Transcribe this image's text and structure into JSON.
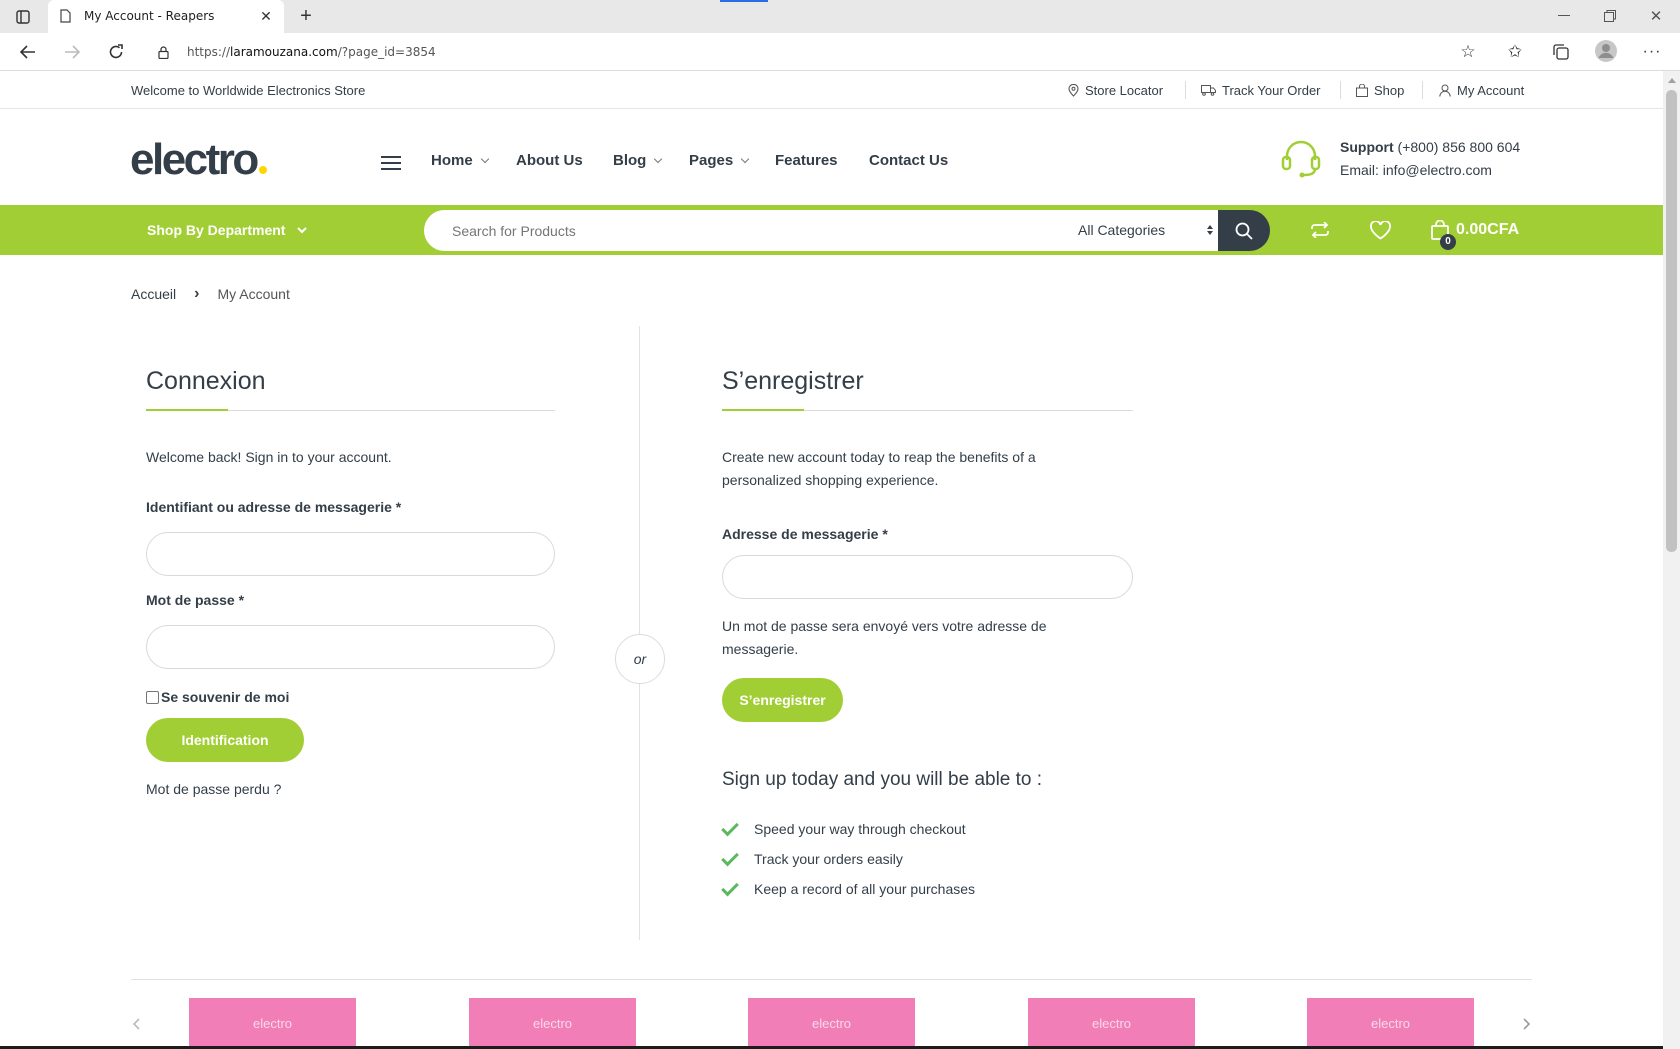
{
  "browser": {
    "tab_title": "My Account - Reapers",
    "url_domain": "laramouzana.com",
    "url_prefix": "https://",
    "url_path": "/?page_id=3854"
  },
  "topbar": {
    "welcome": "Welcome to Worldwide Electronics Store",
    "links": [
      "Store Locator",
      "Track Your Order",
      "Shop",
      "My Account"
    ]
  },
  "header": {
    "logo": "electro",
    "nav": [
      {
        "label": "Home",
        "has_dropdown": true
      },
      {
        "label": "About Us",
        "has_dropdown": false
      },
      {
        "label": "Blog",
        "has_dropdown": true
      },
      {
        "label": "Pages",
        "has_dropdown": true
      },
      {
        "label": "Features",
        "has_dropdown": false
      },
      {
        "label": "Contact Us",
        "has_dropdown": false
      }
    ],
    "support_label": "Support",
    "support_phone": "(+800) 856 800 604",
    "support_email": "Email: info@electro.com"
  },
  "greenbar": {
    "department": "Shop By Department",
    "search_placeholder": "Search for Products",
    "category": "All Categories",
    "cart_total": "0.00CFA",
    "cart_count": "0"
  },
  "breadcrumb": {
    "home": "Accueil",
    "separator": "›",
    "current": "My Account"
  },
  "login": {
    "title": "Connexion",
    "intro": "Welcome back! Sign in to your account.",
    "username_label": "Identifiant ou adresse de messagerie *",
    "password_label": "Mot de passe *",
    "remember": "Se souvenir de moi",
    "submit": "Identification",
    "lost_password": "Mot de passe perdu ?"
  },
  "divider_text": "or",
  "register": {
    "title": "S’enregistrer",
    "intro_line1": "Create new account today to reap the benefits of a",
    "intro_line2": "personalized shopping experience.",
    "email_label": "Adresse de messagerie *",
    "note_line1": "Un mot de passe sera envoyé vers votre adresse de",
    "note_line2": "messagerie.",
    "submit": "S’enregistrer",
    "benefits_title": "Sign up today and you will be able to :",
    "benefits": [
      "Speed your way through checkout",
      "Track your orders easily",
      "Keep a record of all your purchases"
    ]
  },
  "brands": [
    "electro",
    "electro",
    "electro",
    "electro",
    "electro"
  ],
  "colors": {
    "accent": "#a2ce35",
    "dark": "#333e48",
    "brand_tile": "#f27eb8"
  }
}
